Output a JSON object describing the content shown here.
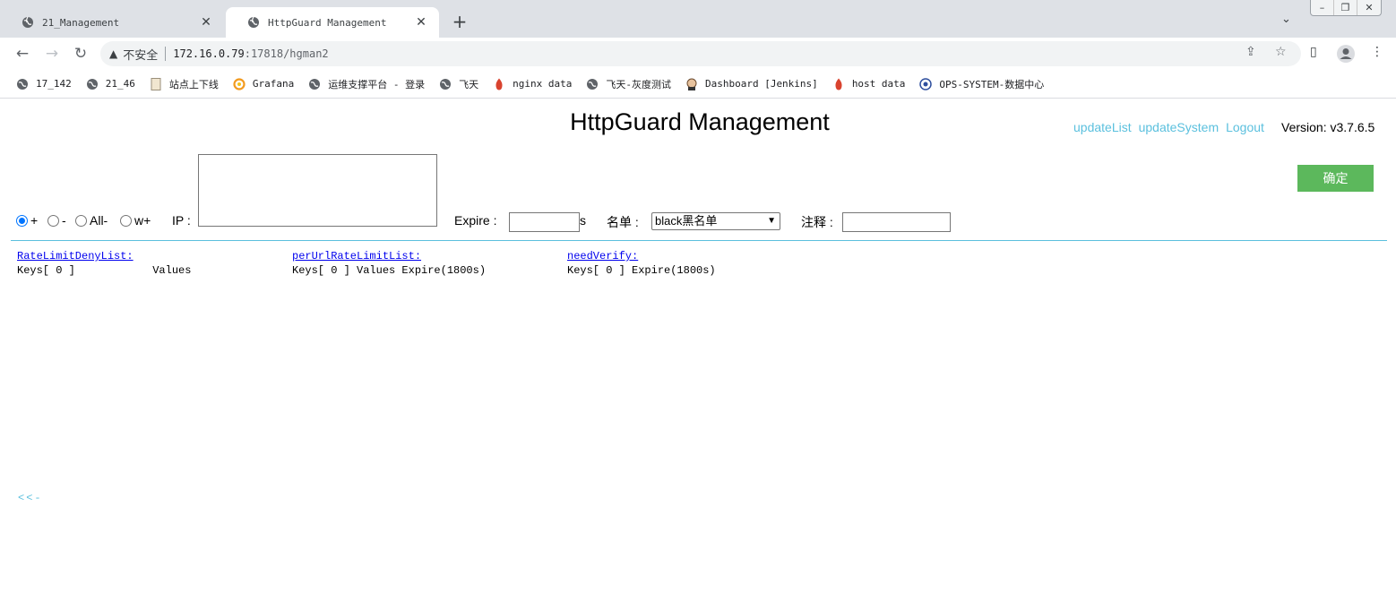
{
  "browser": {
    "tabs": [
      {
        "title": "21_Management",
        "active": false
      },
      {
        "title": "HttpGuard Management",
        "active": true
      }
    ],
    "security_label": "不安全",
    "url_host": "172.16.0.79",
    "url_rest": ":17818/hgman2",
    "bookmarks": [
      {
        "label": "17_142",
        "icon": "globe-icon"
      },
      {
        "label": "21_46",
        "icon": "globe-icon"
      },
      {
        "label": "站点上下线",
        "icon": "page-icon"
      },
      {
        "label": "Grafana",
        "icon": "grafana-icon"
      },
      {
        "label": "运维支撑平台 - 登录",
        "icon": "globe-icon"
      },
      {
        "label": "飞天",
        "icon": "globe-icon"
      },
      {
        "label": "nginx data",
        "icon": "flame-icon"
      },
      {
        "label": "飞天-灰度测试",
        "icon": "globe-icon"
      },
      {
        "label": "Dashboard [Jenkins]",
        "icon": "jenkins-icon"
      },
      {
        "label": "host data",
        "icon": "flame-icon"
      },
      {
        "label": "OPS-SYSTEM-数据中心",
        "icon": "eye-icon"
      }
    ]
  },
  "page": {
    "title": "HttpGuard Management",
    "links": [
      "updateList",
      "updateSystem",
      "Logout"
    ],
    "version": "Version: v3.7.6.5",
    "confirm_label": "确定",
    "radios": [
      {
        "label": "+",
        "checked": true
      },
      {
        "label": "-",
        "checked": false
      },
      {
        "label": "All-",
        "checked": false
      },
      {
        "label": "w+",
        "checked": false
      }
    ],
    "ip_label": "IP :",
    "expire_label": "Expire :",
    "expire_unit": "s",
    "list_label": "名单 :",
    "list_selected": "black黑名单",
    "note_label": "注释 :",
    "columns": [
      {
        "title": "RateLimitDenyList:",
        "sub": "Keys[ 0 ]            Values"
      },
      {
        "title": "perUrlRateLimitList:",
        "sub": "Keys[ 0 ] Values Expire(1800s)"
      },
      {
        "title": "needVerify:",
        "sub": "Keys[ 0 ] Expire(1800s)"
      }
    ],
    "back_link": "<<-"
  },
  "colors": {
    "accent": "#5bc0de",
    "confirm": "#5cb85c",
    "radio": "#0075ff"
  }
}
